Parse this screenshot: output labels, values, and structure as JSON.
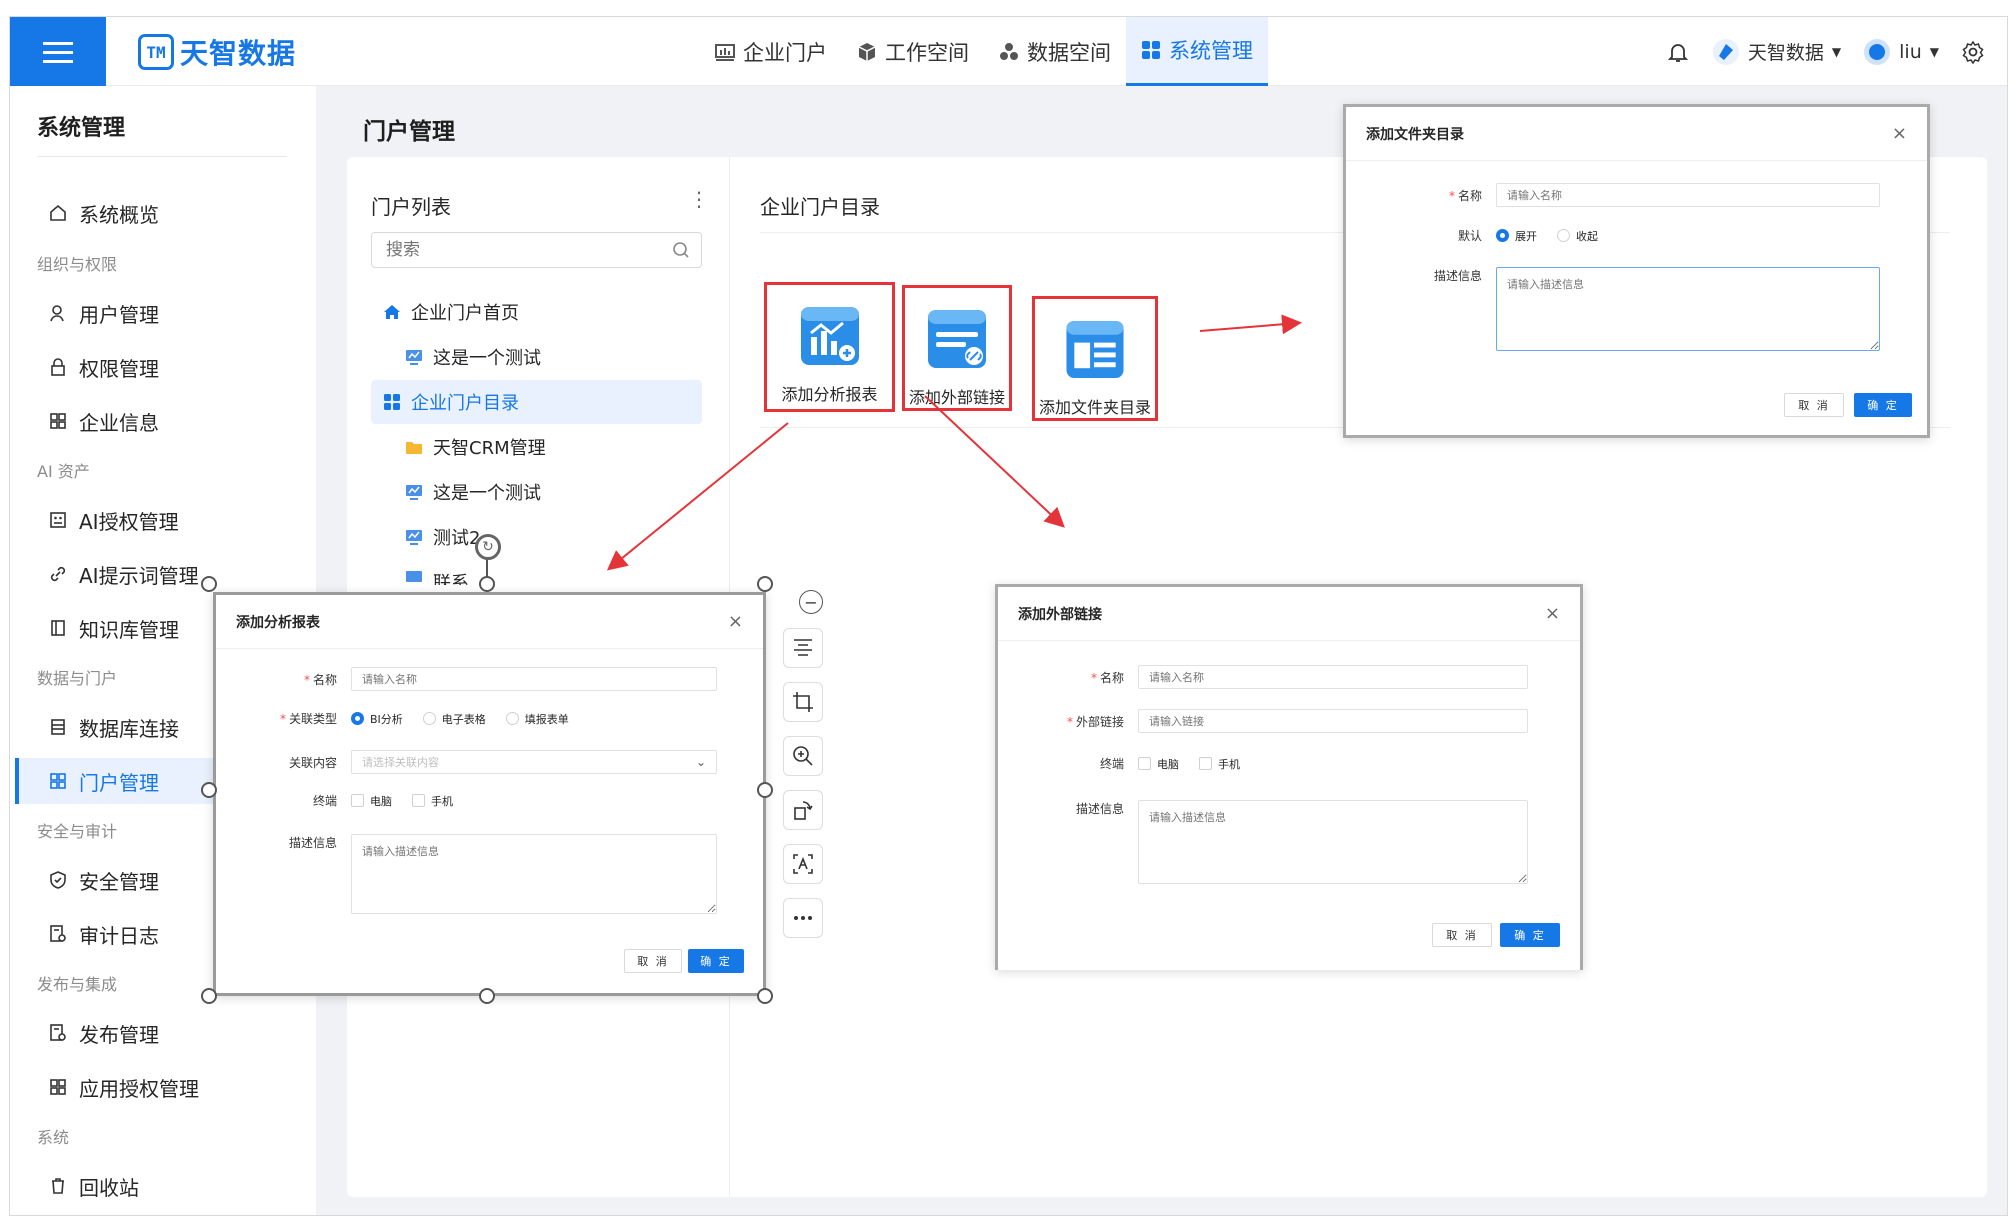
{
  "logo": {
    "mark": "TM",
    "text": "天智数据"
  },
  "topnav": [
    {
      "label": "企业门户",
      "icon": "chart-icon"
    },
    {
      "label": "工作空间",
      "icon": "cube-icon"
    },
    {
      "label": "数据空间",
      "icon": "molecule-icon"
    },
    {
      "label": "系统管理",
      "icon": "grid-icon",
      "active": true
    }
  ],
  "topright": {
    "org": "天智数据",
    "user": "liu"
  },
  "sidebar": {
    "title": "系统管理",
    "sections": {
      "org": "组织与权限",
      "ai": "AI 资产",
      "data": "数据与门户",
      "sec": "安全与审计",
      "pub": "发布与集成",
      "sys": "系统"
    },
    "items": {
      "overview": "系统概览",
      "users": "用户管理",
      "perm": "权限管理",
      "company": "企业信息",
      "ai_auth": "AI授权管理",
      "ai_prompt": "AI提示词管理",
      "kb": "知识库管理",
      "db": "数据库连接",
      "portal": "门户管理",
      "security": "安全管理",
      "audit": "审计日志",
      "publish": "发布管理",
      "app_auth": "应用授权管理",
      "recycle": "回收站"
    }
  },
  "page_title": "门户管理",
  "portal_list": {
    "title": "门户列表",
    "search_placeholder": "搜索",
    "tree": {
      "home": "企业门户首页",
      "test1": "这是一个测试",
      "catalog": "企业门户目录",
      "crm": "天智CRM管理",
      "test2": "这是一个测试",
      "test3": "测试2",
      "partial": "联系"
    }
  },
  "catalog": {
    "title": "企业门户目录",
    "cards": {
      "report": "添加分析报表",
      "link": "添加外部链接",
      "folder": "添加文件夹目录"
    }
  },
  "dialog_folder": {
    "title": "添加文件夹目录",
    "name_label": "名称",
    "name_ph": "请输入名称",
    "default_label": "默认",
    "expand": "展开",
    "collapse": "收起",
    "desc_label": "描述信息",
    "desc_ph": "请输入描述信息",
    "cancel": "取 消",
    "ok": "确 定"
  },
  "dialog_report": {
    "title": "添加分析报表",
    "name_label": "名称",
    "name_ph": "请输入名称",
    "type_label": "关联类型",
    "type_bi": "BI分析",
    "type_sheet": "电子表格",
    "type_form": "填报表单",
    "content_label": "关联内容",
    "content_ph": "请选择关联内容",
    "term_label": "终端",
    "pc": "电脑",
    "mobile": "手机",
    "desc_label": "描述信息",
    "desc_ph": "请输入描述信息",
    "cancel": "取 消",
    "ok": "确 定"
  },
  "dialog_link": {
    "title": "添加外部链接",
    "name_label": "名称",
    "name_ph": "请输入名称",
    "link_label": "外部链接",
    "link_ph": "请输入链接",
    "term_label": "终端",
    "pc": "电脑",
    "mobile": "手机",
    "desc_label": "描述信息",
    "desc_ph": "请输入描述信息",
    "cancel": "取 消",
    "ok": "确 定"
  },
  "colors": {
    "primary": "#1677e6",
    "annotation_red": "#e5333a"
  }
}
